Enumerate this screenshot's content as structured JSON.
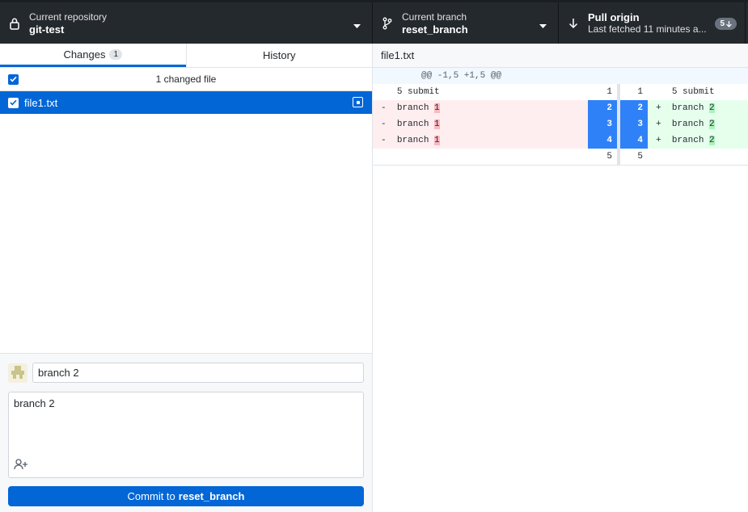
{
  "toolbar": {
    "repository": {
      "label": "Current repository",
      "value": "git-test"
    },
    "branch": {
      "label": "Current branch",
      "value": "reset_branch"
    },
    "pull": {
      "label": "Pull origin",
      "sublabel": "Last fetched 11 minutes a...",
      "badge": "5"
    }
  },
  "tabs": [
    {
      "label": "Changes",
      "count": "1"
    },
    {
      "label": "History"
    }
  ],
  "changes": {
    "summary": "1 changed file",
    "files": [
      {
        "name": "file1.txt"
      }
    ]
  },
  "commit": {
    "summary_value": "branch 2",
    "description_value": "branch 2",
    "button_prefix": "Commit to",
    "button_branch": "reset_branch"
  },
  "diff": {
    "file": "file1.txt",
    "hunk": "@@ -1,5 +1,5 @@",
    "rows": [
      {
        "type": "context",
        "old": "1",
        "new": "1",
        "left_text": "5 submit",
        "right_text": "5 submit"
      },
      {
        "type": "change",
        "old": "2",
        "new": "2",
        "left_prefix": "-",
        "left_text": "branch ",
        "left_hl": "1",
        "right_prefix": "+",
        "right_text": "branch ",
        "right_hl": "2"
      },
      {
        "type": "change",
        "old": "3",
        "new": "3",
        "left_prefix": "-",
        "left_text": "branch ",
        "left_hl": "1",
        "right_prefix": "+",
        "right_text": "branch ",
        "right_hl": "2"
      },
      {
        "type": "change",
        "old": "4",
        "new": "4",
        "left_prefix": "-",
        "left_text": "branch ",
        "left_hl": "1",
        "right_prefix": "+",
        "right_text": "branch ",
        "right_hl": "2"
      },
      {
        "type": "context",
        "old": "5",
        "new": "5",
        "left_text": "",
        "right_text": ""
      }
    ]
  },
  "colors": {
    "toolbar_bg": "#24292e",
    "accent": "#0366d6",
    "deleted_bg": "#ffeef0",
    "added_bg": "#e6ffed",
    "selected_gutter": "#2f81f7"
  }
}
